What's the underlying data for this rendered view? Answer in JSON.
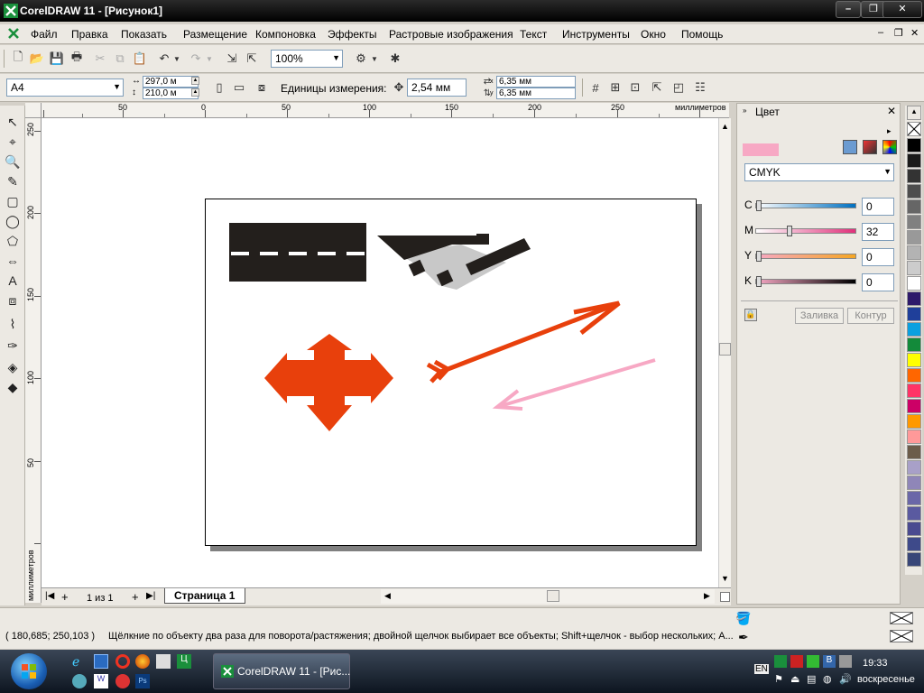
{
  "window": {
    "title": "CorelDRAW 11 - [Рисунок1]",
    "minimize": "–",
    "maximize": "❐",
    "close": "✕"
  },
  "menu": {
    "items": [
      {
        "label": "Файл"
      },
      {
        "label": "Правка"
      },
      {
        "label": "Показать"
      },
      {
        "label": "Размещение"
      },
      {
        "label": "Компоновка"
      },
      {
        "label": "Эффекты"
      },
      {
        "label": "Растровые изображения"
      },
      {
        "label": "Текст"
      },
      {
        "label": "Инструменты"
      },
      {
        "label": "Окно"
      },
      {
        "label": "Помощь"
      }
    ],
    "doc_min": "–",
    "doc_max": "❐",
    "doc_close": "✕"
  },
  "standard_toolbar": {
    "zoom": "100%"
  },
  "property_bar": {
    "paper_size": "A4",
    "width": "297,0 м",
    "height": "210,0 м",
    "units_label": "Единицы измерения:",
    "nudge": "2,54 мм",
    "dup_x": "6,35 мм",
    "dup_y": "6,35 мм",
    "x_label": "x",
    "y_label": "y"
  },
  "rulers": {
    "h_labels": [
      "50",
      "0",
      "50",
      "100",
      "150",
      "200",
      "250"
    ],
    "h_unit": "миллиметров",
    "v_labels": [
      "250",
      "200",
      "150",
      "100",
      "50"
    ],
    "v_unit": "миллиметров"
  },
  "page_nav": {
    "counter": "1 из 1",
    "tab": "Страница 1"
  },
  "docker": {
    "title": "Цвет",
    "model": "CMYK",
    "preview_color": "#f7a8c4",
    "channels": [
      {
        "label": "C",
        "value": "0",
        "level": 0,
        "gradient": "linear-gradient(90deg,#fff,#0070c0)"
      },
      {
        "label": "M",
        "value": "32",
        "level": 0.32,
        "gradient": "linear-gradient(90deg,#fff,#e0307a)"
      },
      {
        "label": "Y",
        "value": "0",
        "level": 0,
        "gradient": "linear-gradient(90deg,#f7a8c4,#f5a623)"
      },
      {
        "label": "K",
        "value": "0",
        "level": 0,
        "gradient": "linear-gradient(90deg,#f7a8c4,#000)"
      }
    ],
    "fill_label": "Заливка",
    "outline_label": "Контур"
  },
  "palette": {
    "colors": [
      "#000000",
      "#1a1a1a",
      "#333333",
      "#4d4d4d",
      "#666666",
      "#808080",
      "#999999",
      "#b3b3b3",
      "#cccccc",
      "#ffffff",
      "#2e1a6b",
      "#1f3f9a",
      "#0aa0e0",
      "#138a3a",
      "#ffff00",
      "#ff6600",
      "#ff3366",
      "#cc0066",
      "#ff9900",
      "#ff9999",
      "#6b5c4a",
      "#a8a0c8",
      "#8f86b8",
      "#6a67a8",
      "#5a5aa0",
      "#4a4a90",
      "#3e4a8a",
      "#384678"
    ]
  },
  "status": {
    "coords": "( 180,685; 250,103 )",
    "hint": "Щёлкние по объекту два раза для поворота/растяжения; двойной щелчок выбирает все объекты; Shift+щелчок - выбор нескольких; A..."
  },
  "taskbar": {
    "task": "CorelDRAW 11 - [Рис...",
    "lang": "EN",
    "time": "19:33",
    "day": "воскресенье"
  },
  "shapes": {
    "road_color": "#231f1c",
    "orange": "#e8400c",
    "pink": "#f7a8c4",
    "gray": "#c8c8c8"
  }
}
